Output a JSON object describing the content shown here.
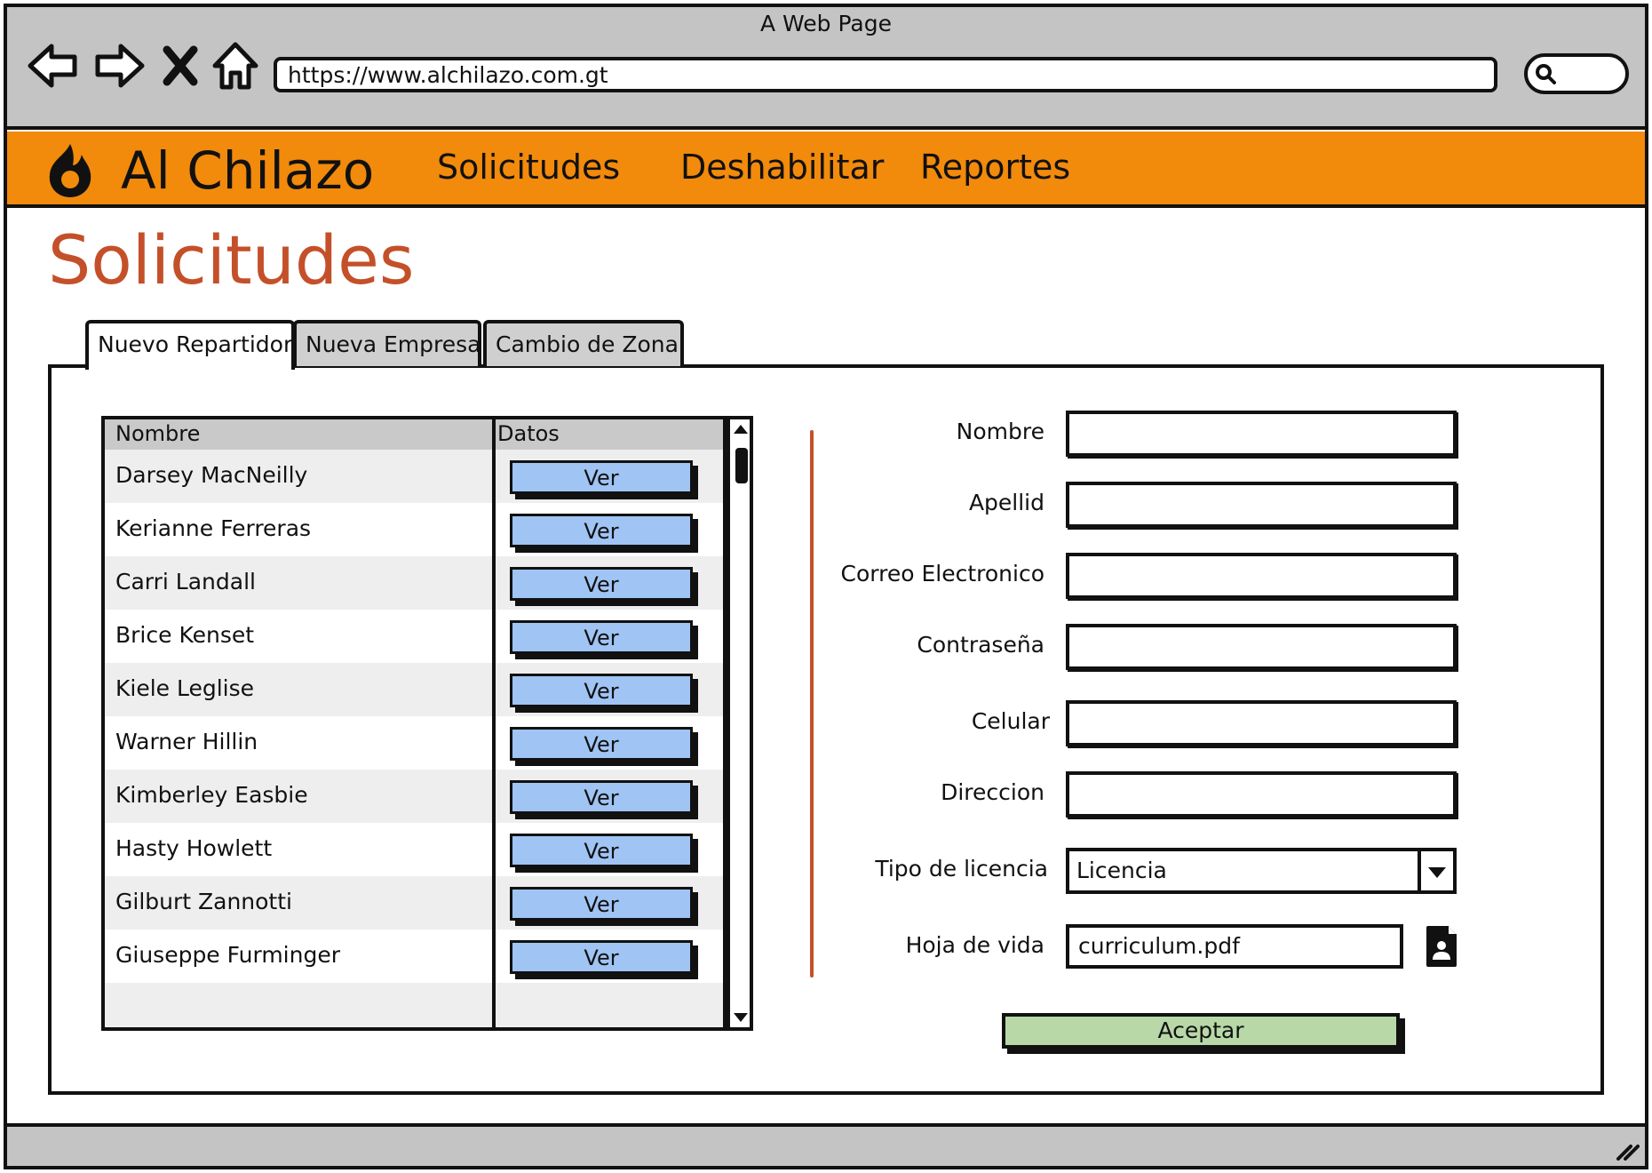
{
  "browser": {
    "window_title": "A Web Page",
    "url": "https://www.alchilazo.com.gt"
  },
  "header": {
    "brand": "Al Chilazo",
    "nav": [
      {
        "label": "Solicitudes"
      },
      {
        "label": "Deshabilitar"
      },
      {
        "label": "Reportes"
      }
    ],
    "accent_color": "#f28a0c"
  },
  "page": {
    "title": "Solicitudes",
    "title_color": "#c4502a"
  },
  "tabs": [
    {
      "label": "Nuevo Repartidor",
      "active": true
    },
    {
      "label": "Nueva Empresa",
      "active": false
    },
    {
      "label": "Cambio de Zona",
      "active": false
    }
  ],
  "table": {
    "columns": [
      "Nombre",
      "Datos"
    ],
    "action_label": "Ver",
    "rows": [
      {
        "name": "Darsey MacNeilly"
      },
      {
        "name": "Kerianne Ferreras"
      },
      {
        "name": "Carri Landall"
      },
      {
        "name": "Brice Kenset"
      },
      {
        "name": "Kiele Leglise"
      },
      {
        "name": "Warner Hillin"
      },
      {
        "name": "Kimberley Easbie"
      },
      {
        "name": "Hasty Howlett"
      },
      {
        "name": "Gilburt Zannotti"
      },
      {
        "name": "Giuseppe Furminger"
      }
    ]
  },
  "form": {
    "fields": [
      {
        "label": "Nombre",
        "value": ""
      },
      {
        "label": "Apellid",
        "value": ""
      },
      {
        "label": "Correo Electronico",
        "value": ""
      },
      {
        "label": "Contraseña",
        "value": ""
      },
      {
        "label": "Celular",
        "value": ""
      },
      {
        "label": "Direccion",
        "value": ""
      }
    ],
    "license_label": "Tipo de licencia",
    "license_value": "Licencia",
    "cv_label": "Hoja de vida",
    "cv_value": "curriculum.pdf",
    "submit_label": "Aceptar"
  }
}
